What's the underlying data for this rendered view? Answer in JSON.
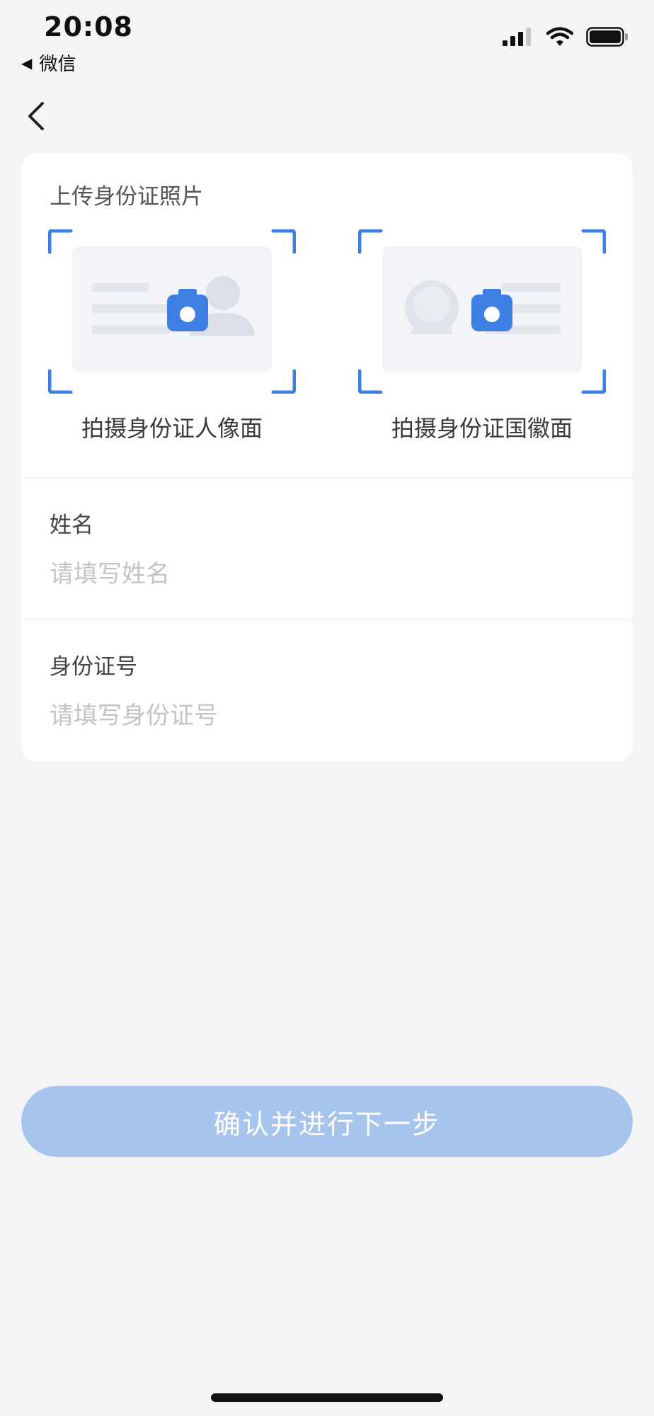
{
  "status_bar": {
    "time": "20:08",
    "back_app_label": "微信",
    "icons": [
      "cellular-signal-icon",
      "wifi-icon",
      "battery-icon"
    ]
  },
  "nav": {
    "back_icon": "chevron-left-icon"
  },
  "upload": {
    "title": "上传身份证照片",
    "front_label": "拍摄身份证人像面",
    "back_label": "拍摄身份证国徽面"
  },
  "form": {
    "name_label": "姓名",
    "name_placeholder": "请填写姓名",
    "name_value": "",
    "id_label": "身份证号",
    "id_placeholder": "请填写身份证号",
    "id_value": ""
  },
  "confirm_button": {
    "label": "确认并进行下一步"
  },
  "colors": {
    "accent": "#3d7fe3",
    "button_disabled": "#a7c4ec",
    "background": "#f4f4f6",
    "card": "#ffffff",
    "placeholder": "#c4c4c8"
  }
}
